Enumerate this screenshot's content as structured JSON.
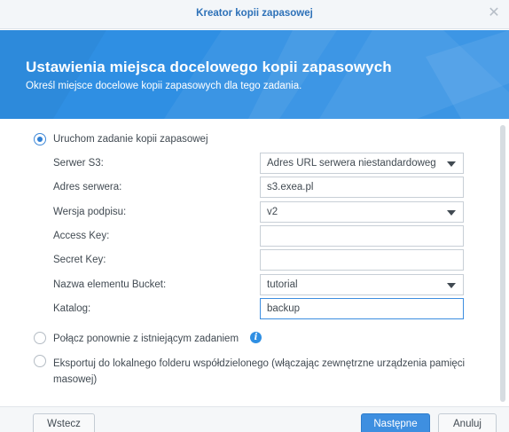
{
  "window": {
    "title": "Kreator kopii zapasowej"
  },
  "banner": {
    "title": "Ustawienia miejsca docelowego kopii zapasowych",
    "subtitle": "Określ miejsce docelowe kopii zapasowych dla tego zadania."
  },
  "options": {
    "create_task": "Uruchom zadanie kopii zapasowej",
    "relink_task": "Połącz ponownie z istniejącym zadaniem",
    "export_local": "Eksportuj do lokalnego folderu współdzielonego (włączając zewnętrzne urządzenia pamięci masowej)"
  },
  "form": {
    "s3_server_label": "Serwer S3:",
    "s3_server_value": "Adres URL serwera niestandardowego",
    "server_address_label": "Adres serwera:",
    "server_address_value": "s3.exea.pl",
    "signature_label": "Wersja podpisu:",
    "signature_value": "v2",
    "access_key_label": "Access Key:",
    "access_key_value": "",
    "secret_key_label": "Secret Key:",
    "secret_key_value": "",
    "bucket_label": "Nazwa elementu Bucket:",
    "bucket_value": "tutorial",
    "directory_label": "Katalog:",
    "directory_value": "backup"
  },
  "buttons": {
    "back": "Wstecz",
    "next": "Następne",
    "cancel": "Anuluj"
  },
  "icons": {
    "close": "close-icon",
    "info": "info-icon",
    "dropdown": "chevron-down-icon"
  },
  "colors": {
    "banner": "#2f8fe3",
    "title_text": "#2d71b8",
    "primary_button": "#3e8fe0"
  }
}
